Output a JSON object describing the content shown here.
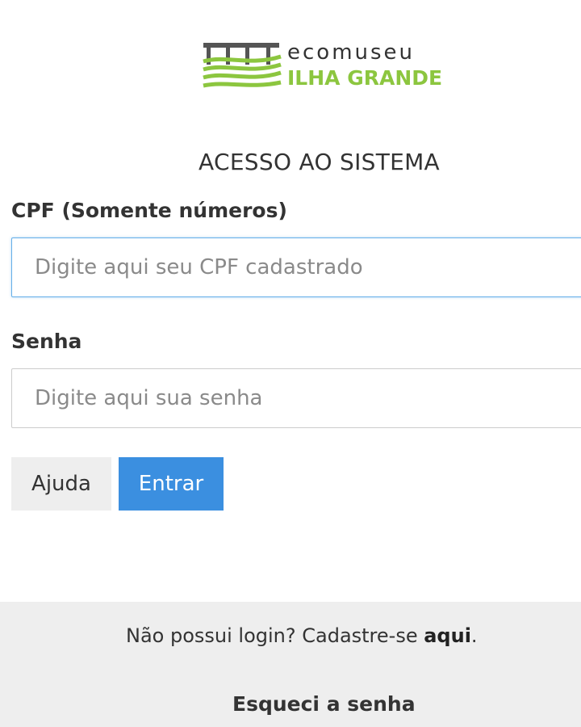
{
  "logo": {
    "word_top": "ecomuseu",
    "word_bottom": "ILHA GRANDE",
    "brand_green": "#8cc63f",
    "brand_gray": "#555555",
    "icon": "ecomuseu-logo-mark"
  },
  "heading": "ACESSO AO SISTEMA",
  "form": {
    "cpf_label": "CPF (Somente números)",
    "cpf_placeholder": "Digite aqui seu CPF cadastrado",
    "cpf_value": "",
    "password_label": "Senha",
    "password_placeholder": "Digite aqui sua senha",
    "password_value": ""
  },
  "buttons": {
    "help": "Ajuda",
    "enter": "Entrar",
    "enter_color": "#3b8fe0"
  },
  "footer": {
    "signup_text": "Não possui login? Cadastre-se ",
    "signup_link": "aqui",
    "signup_suffix": ".",
    "forgot": "Esqueci a senha"
  }
}
